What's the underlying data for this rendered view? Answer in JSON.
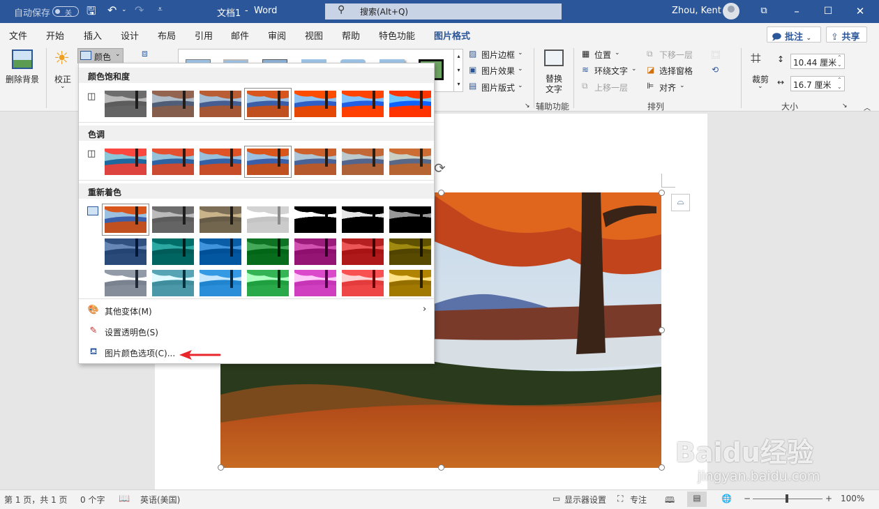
{
  "titlebar": {
    "autosave_label": "自动保存",
    "toggle_state": "关",
    "document_title": "文档1",
    "separator": "-",
    "app_name": "Word",
    "search_placeholder": "搜索(Alt+Q)",
    "user_name": "Zhou, Kent"
  },
  "tabs": [
    "文件",
    "开始",
    "插入",
    "设计",
    "布局",
    "引用",
    "邮件",
    "审阅",
    "视图",
    "帮助",
    "特色功能",
    "图片格式"
  ],
  "active_tab": "图片格式",
  "header_buttons": {
    "comments": "批注",
    "share": "共享"
  },
  "ribbon": {
    "remove_bg": "删除背景",
    "corrections": "校正",
    "color": "颜色",
    "picture_border": "图片边框",
    "picture_effects": "图片效果",
    "picture_layout": "图片版式",
    "alt_text_line1": "替换",
    "alt_text_line2": "文字",
    "accessibility_group": "辅助功能",
    "position": "位置",
    "wrap_text": "环绕文字",
    "bring_forward": "上移一层",
    "send_backward": "下移一层",
    "selection_pane": "选择窗格",
    "align": "对齐",
    "arrange_group": "排列",
    "crop": "裁剪",
    "height": "10.44 厘米",
    "width": "16.7 厘米",
    "size_group": "大小"
  },
  "color_menu": {
    "saturation_header": "颜色饱和度",
    "tone_header": "色调",
    "recolor_header": "重新着色",
    "more_variations": "其他变体(M)",
    "set_transparent": "设置透明色(S)",
    "color_options": "图片颜色选项(C)..."
  },
  "statusbar": {
    "page": "第 1 页，共 1 页",
    "words": "0 个字",
    "language": "英语(美国)",
    "display_settings": "显示器设置",
    "focus": "专注",
    "zoom": "100%"
  },
  "watermark": {
    "logo": "Baidu经验",
    "url": "jingyan.baidu.com"
  },
  "colors": {
    "accent": "#2b579a",
    "arrow": "#e8262b"
  }
}
